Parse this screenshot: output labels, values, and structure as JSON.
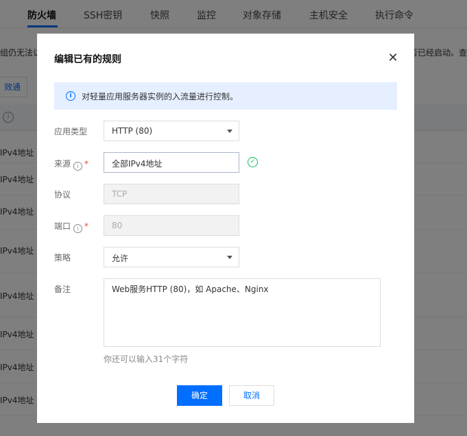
{
  "tabs": [
    "防火墙",
    "SSH密钥",
    "快照",
    "监控",
    "对象存储",
    "主机安全",
    "执行命令"
  ],
  "notice": {
    "left_text": "组仍无法访",
    "right_text": "否已经启动。查"
  },
  "toolbar": {
    "button_label": "效通"
  },
  "background_rows": [
    "IPv4地址",
    "IPv4地址",
    "IPv4地址",
    "IPv4地址",
    "IPv4地址",
    "IPv4地址",
    "IPv4地址",
    "IPv4地址"
  ],
  "dialog": {
    "title": "编辑已有的规则",
    "tip": "对轻量应用服务器实例的入流量进行控制。",
    "fields": {
      "app_type": {
        "label": "应用类型",
        "value": "HTTP (80)"
      },
      "source": {
        "label": "来源",
        "value": "全部IPv4地址"
      },
      "protocol": {
        "label": "协议",
        "value": "TCP"
      },
      "port": {
        "label": "端口",
        "value": "80"
      },
      "policy": {
        "label": "策略",
        "value": "允许"
      },
      "remark": {
        "label": "备注",
        "value": "Web服务HTTP (80)，如 Apache、Nginx",
        "hint": "你还可以输入31个字符"
      }
    },
    "buttons": {
      "confirm": "确定",
      "cancel": "取消"
    }
  },
  "colors": {
    "primary": "#006eff",
    "success": "#0abf5b",
    "required": "#e54545",
    "tip_bg": "#e5efff"
  }
}
